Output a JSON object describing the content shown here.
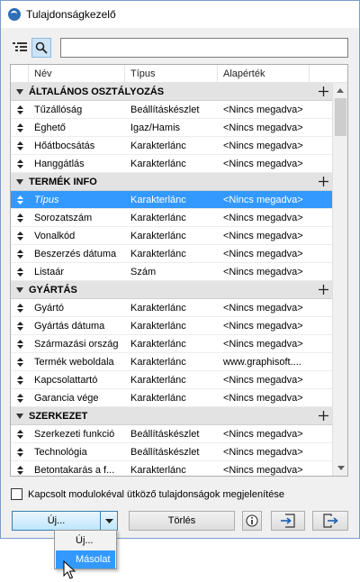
{
  "window": {
    "title": "Tulajdonságkezelő"
  },
  "search": {
    "value": ""
  },
  "table": {
    "headers": [
      "Név",
      "Típus",
      "Alapérték"
    ],
    "groups": [
      {
        "label": "ÁLTALÁNOS OSZTÁLYOZÁS",
        "rows": [
          [
            "Tűzállóság",
            "Beállításkészlet",
            "<Nincs megadva>"
          ],
          [
            "Éghető",
            "Igaz/Hamis",
            "<Nincs megadva>"
          ],
          [
            "Hőátbocsátás",
            "Karakterlánc",
            "<Nincs megadva>"
          ],
          [
            "Hanggátlás",
            "Karakterlánc",
            "<Nincs megadva>"
          ]
        ]
      },
      {
        "label": "TERMÉK INFO",
        "rows": [
          [
            "Típus",
            "Karakterlánc",
            "<Nincs megadva>"
          ],
          [
            "Sorozatszám",
            "Karakterlánc",
            "<Nincs megadva>"
          ],
          [
            "Vonalkód",
            "Karakterlánc",
            "<Nincs megadva>"
          ],
          [
            "Beszerzés dátuma",
            "Karakterlánc",
            "<Nincs megadva>"
          ],
          [
            "Listaár",
            "Szám",
            "<Nincs megadva>"
          ]
        ]
      },
      {
        "label": "GYÁRTÁS",
        "rows": [
          [
            "Gyártó",
            "Karakterlánc",
            "<Nincs megadva>"
          ],
          [
            "Gyártás dátuma",
            "Karakterlánc",
            "<Nincs megadva>"
          ],
          [
            "Származási ország",
            "Karakterlánc",
            "<Nincs megadva>"
          ],
          [
            "Termék weboldala",
            "Karakterlánc",
            "www.graphisoft...."
          ],
          [
            "Kapcsolattartó",
            "Karakterlánc",
            "<Nincs megadva>"
          ],
          [
            "Garancia vége",
            "Karakterlánc",
            "<Nincs megadva>"
          ]
        ]
      },
      {
        "label": "SZERKEZET",
        "rows": [
          [
            "Szerkezeti funkció",
            "Beállításkészlet",
            "<Nincs megadva>"
          ],
          [
            "Technológia",
            "Beállításkészlet",
            "<Nincs megadva>"
          ],
          [
            "Betontakarás a f...",
            "Karakterlánc",
            "<Nincs megadva>"
          ]
        ]
      }
    ],
    "selected_row": "Típus"
  },
  "checkbox": {
    "label": "Kapcsolt modulokéval ütköző tulajdonságok megjelenítése",
    "checked": false
  },
  "buttons": {
    "new": "Új...",
    "delete": "Törlés"
  },
  "dropdown": {
    "items": [
      "Új...",
      "Másolat"
    ],
    "highlighted": "Másolat"
  },
  "colors": {
    "selection": "#3399ff",
    "group_bg": "#e3e3e3"
  },
  "icons": [
    "app-logo-icon",
    "tree-view-icon",
    "search-icon",
    "drag-handle-icon",
    "collapse-triangle-icon",
    "plus-icon",
    "dropdown-arrow-icon",
    "info-icon",
    "import-icon",
    "export-icon",
    "cursor-icon"
  ]
}
